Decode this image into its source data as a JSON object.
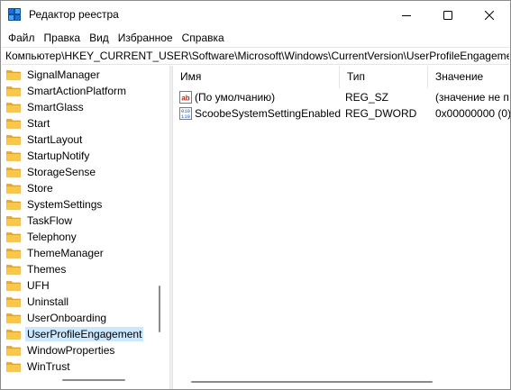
{
  "window": {
    "title": "Редактор реестра"
  },
  "menu": [
    "Файл",
    "Правка",
    "Вид",
    "Избранное",
    "Справка"
  ],
  "address": "Компьютер\\HKEY_CURRENT_USER\\Software\\Microsoft\\Windows\\CurrentVersion\\UserProfileEngagement",
  "tree": {
    "items": [
      "SignalManager",
      "SmartActionPlatform",
      "SmartGlass",
      "Start",
      "StartLayout",
      "StartupNotify",
      "StorageSense",
      "Store",
      "SystemSettings",
      "TaskFlow",
      "Telephony",
      "ThemeManager",
      "Themes",
      "UFH",
      "Uninstall",
      "UserOnboarding",
      "UserProfileEngagement",
      "WindowProperties",
      "WinTrust"
    ],
    "selected": "UserProfileEngagement"
  },
  "list": {
    "columns": [
      "Имя",
      "Тип",
      "Значение"
    ],
    "rows": [
      {
        "icon": "string-value-icon",
        "name": "(По умолчанию)",
        "type": "REG_SZ",
        "value": "(значение не п"
      },
      {
        "icon": "binary-value-icon",
        "name": "ScoobeSystemSettingEnabled",
        "type": "REG_DWORD",
        "value": "0x00000000 (0)"
      }
    ]
  },
  "colors": {
    "selection": "#cce8ff",
    "folder": "#f8c846",
    "accent": "#0078d4"
  }
}
